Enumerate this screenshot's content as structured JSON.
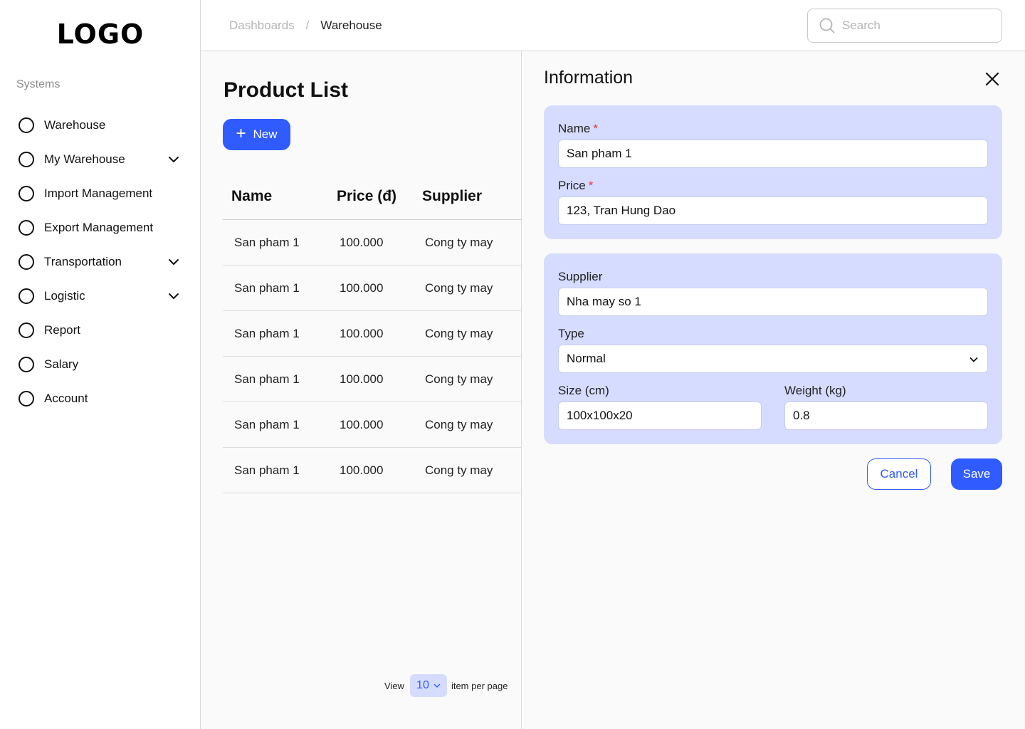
{
  "sidebar": {
    "logo": "LOGO",
    "section_label": "Systems",
    "items": [
      {
        "label": "Warehouse",
        "has_chevron": false
      },
      {
        "label": "My Warehouse",
        "has_chevron": true
      },
      {
        "label": "Import Management",
        "has_chevron": false
      },
      {
        "label": "Export Management",
        "has_chevron": false
      },
      {
        "label": "Transportation",
        "has_chevron": true
      },
      {
        "label": "Logistic",
        "has_chevron": true
      },
      {
        "label": "Report",
        "has_chevron": false
      },
      {
        "label": "Salary",
        "has_chevron": false
      },
      {
        "label": "Account",
        "has_chevron": false
      }
    ]
  },
  "header": {
    "breadcrumb": {
      "root": "Dashboards",
      "separator": "/",
      "current": "Warehouse"
    },
    "search": {
      "placeholder": "Search",
      "value": ""
    }
  },
  "product_list": {
    "title": "Product List",
    "new_button_label": "New",
    "columns": {
      "name": "Name",
      "price": "Price (đ)",
      "supplier": "Supplier"
    },
    "rows": [
      {
        "name": "San pham 1",
        "price": "100.000",
        "supplier": "Cong ty may"
      },
      {
        "name": "San pham 1",
        "price": "100.000",
        "supplier": "Cong ty may"
      },
      {
        "name": "San pham 1",
        "price": "100.000",
        "supplier": "Cong ty may"
      },
      {
        "name": "San pham 1",
        "price": "100.000",
        "supplier": "Cong ty may"
      },
      {
        "name": "San pham 1",
        "price": "100.000",
        "supplier": "Cong ty may"
      },
      {
        "name": "San pham 1",
        "price": "100.000",
        "supplier": "Cong ty may"
      }
    ],
    "pager": {
      "view_label": "View",
      "per_page_value": "10",
      "suffix_label": "item per page"
    }
  },
  "information": {
    "title": "Information",
    "required_mark": "*",
    "name": {
      "label": "Name",
      "value": "San pham 1"
    },
    "price": {
      "label": "Price",
      "value": "123, Tran Hung Dao"
    },
    "supplier": {
      "label": "Supplier",
      "value": "Nha may so 1"
    },
    "type": {
      "label": "Type",
      "value": "Normal"
    },
    "size": {
      "label": "Size (cm)",
      "value": "100x100x20"
    },
    "weight": {
      "label": "Weight (kg)",
      "value": "0.8"
    },
    "cancel_label": "Cancel",
    "save_label": "Save"
  },
  "colors": {
    "primary": "#2f5bff",
    "card_background": "#d5dcff",
    "required": "#e53935"
  }
}
